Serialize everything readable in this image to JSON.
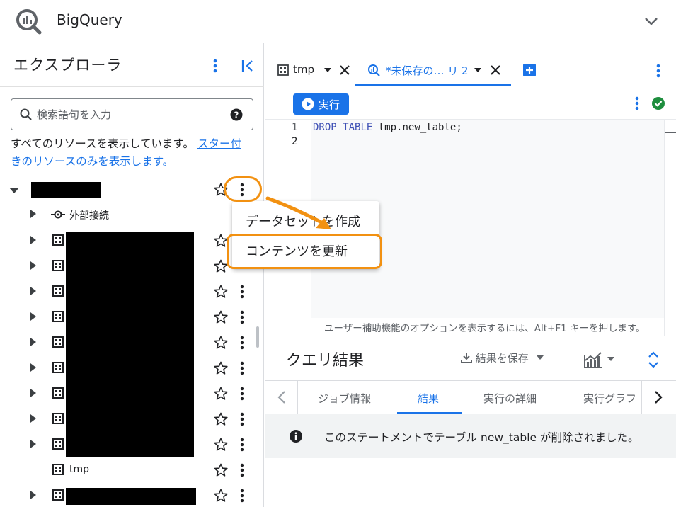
{
  "app": {
    "title": "BigQuery"
  },
  "explorer": {
    "title": "エクスプローラ",
    "search_placeholder": "検索語句を入力",
    "info_text": "すべてのリソースを表示しています。",
    "info_link": "スター付きのリソースのみを表示します。",
    "external_connections_label": "外部接続",
    "tmp_dataset_label": "tmp"
  },
  "tabs": [
    {
      "label": "tmp"
    },
    {
      "label": "*未保存の… リ 2"
    }
  ],
  "editor": {
    "run_label": "実行",
    "line_numbers": [
      "1",
      "2"
    ],
    "code": {
      "kw1": "DROP",
      "kw2": "TABLE",
      "rest": "tmp.new_table;"
    },
    "a11y_hint": "ユーザー補助機能のオプションを表示するには、Alt+F1 キーを押します。"
  },
  "results": {
    "title": "クエリ結果",
    "save_label": "結果を保存",
    "tabs": [
      "ジョブ情報",
      "結果",
      "実行の詳細",
      "実行グラフ"
    ],
    "message": "このステートメントでテーブル new_table が削除されました。"
  },
  "context_menu": {
    "items": [
      "データセットを作成",
      "コンテンツを更新"
    ]
  },
  "colors": {
    "accent": "#1a73e8",
    "highlight": "#f29111",
    "success": "#1e8e3e"
  }
}
